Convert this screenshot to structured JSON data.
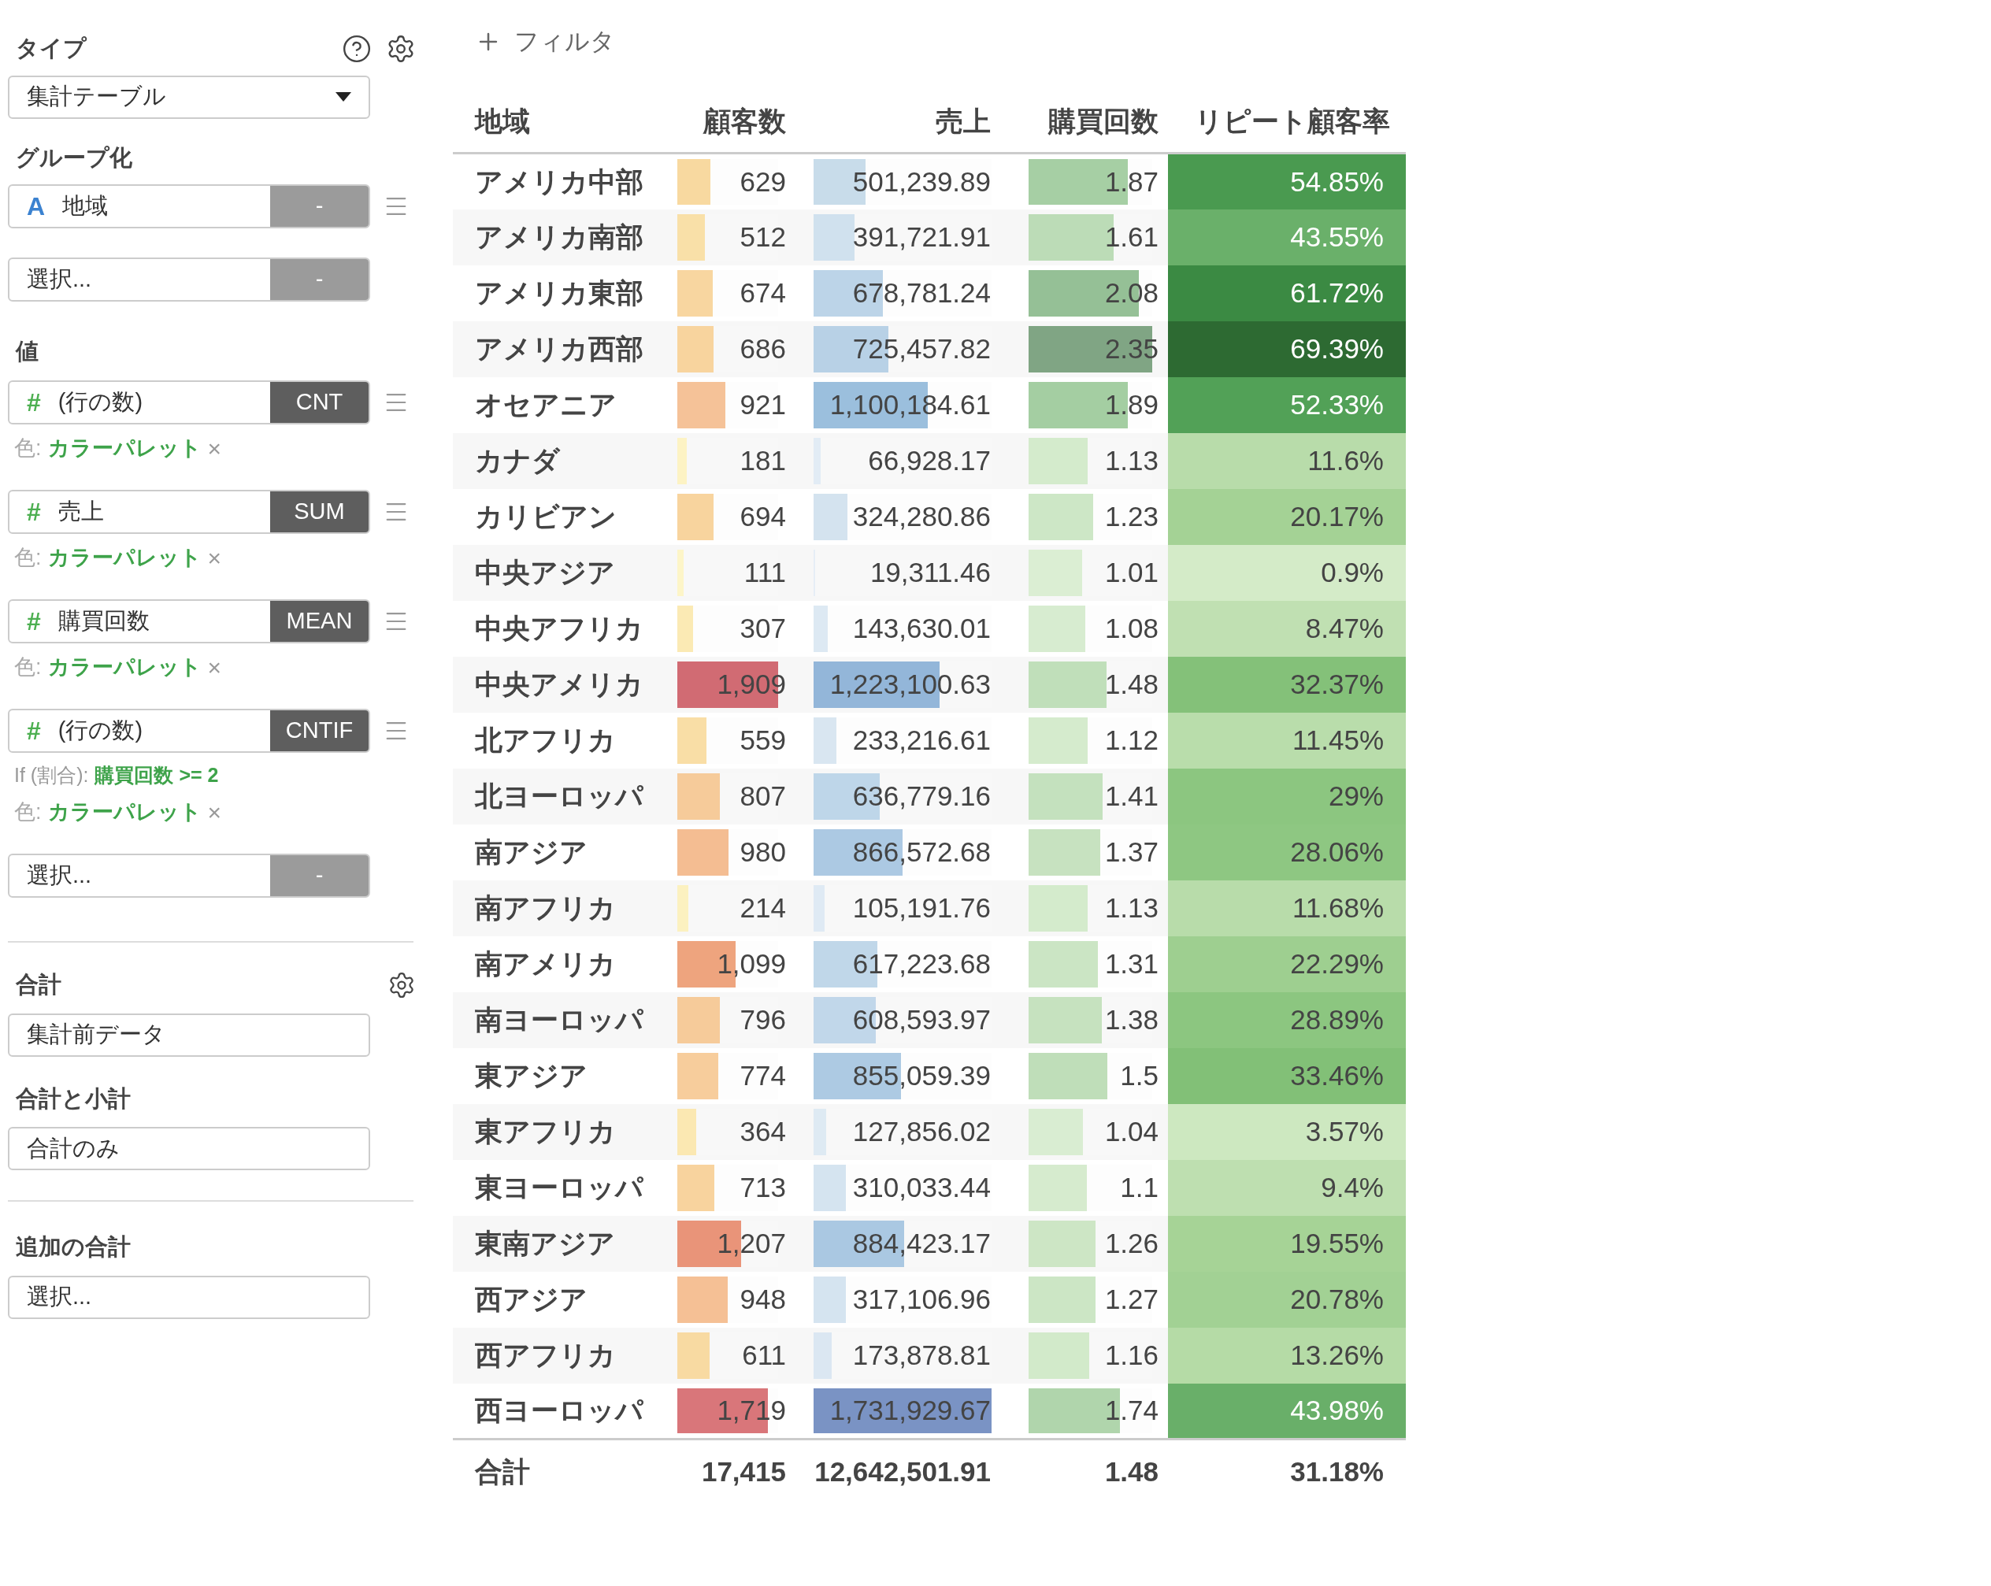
{
  "sidebar": {
    "type_label": "タイプ",
    "type_select": "集計テーブル",
    "grouping_label": "グループ化",
    "groups": [
      {
        "kind": "field",
        "icon": "A",
        "name": "地域",
        "agg": "-"
      },
      {
        "kind": "empty",
        "name": "選択...",
        "agg": "-"
      }
    ],
    "values_label": "値",
    "values": [
      {
        "kind": "field",
        "icon": "#",
        "name": "(行の数)",
        "agg": "CNT",
        "color_label": "色:",
        "color_value": "カラーパレット",
        "remove": "×"
      },
      {
        "kind": "field",
        "icon": "#",
        "name": "売上",
        "agg": "SUM",
        "color_label": "色:",
        "color_value": "カラーパレット",
        "remove": "×"
      },
      {
        "kind": "field",
        "icon": "#",
        "name": "購買回数",
        "agg": "MEAN",
        "color_label": "色:",
        "color_value": "カラーパレット",
        "remove": "×"
      },
      {
        "kind": "field",
        "icon": "#",
        "name": "(行の数)",
        "agg": "CNTIF",
        "condition_label": "If (割合):",
        "condition_value": "購買回数 >= 2",
        "color_label": "色:",
        "color_value": "カラーパレット",
        "remove": "×"
      },
      {
        "kind": "empty",
        "name": "選択...",
        "agg": "-"
      }
    ],
    "total_label": "合計",
    "total_select": "集計前データ",
    "subtotal_label": "合計と小計",
    "subtotal_select": "合計のみ",
    "extra_label": "追加の合計",
    "extra_select": "選択..."
  },
  "filter": "フィルタ",
  "table": {
    "columns": [
      "地域",
      "顧客数",
      "売上",
      "購買回数",
      "リピート顧客率"
    ],
    "rows": [
      {
        "region": "アメリカ中部",
        "count": {
          "text": "629",
          "level": 0.33,
          "color": "#f8d9a0"
        },
        "sales": {
          "text": "501,239.89",
          "level": 0.29,
          "color": "#c8dcea"
        },
        "purchases": {
          "text": "1.87",
          "level": 0.8,
          "color": "#a6cfa4"
        },
        "repeat": {
          "text": "54.85%",
          "color": "#4a9a50"
        }
      },
      {
        "region": "アメリカ南部",
        "count": {
          "text": "512",
          "level": 0.27,
          "color": "#f9e0a8"
        },
        "sales": {
          "text": "391,721.91",
          "level": 0.23,
          "color": "#d0e1ee"
        },
        "purchases": {
          "text": "1.61",
          "level": 0.69,
          "color": "#bcdcb7"
        },
        "repeat": {
          "text": "43.55%",
          "color": "#6ab06a"
        }
      },
      {
        "region": "アメリカ東部",
        "count": {
          "text": "674",
          "level": 0.35,
          "color": "#f8d6a0"
        },
        "sales": {
          "text": "678,781.24",
          "level": 0.39,
          "color": "#bcd4e8"
        },
        "purchases": {
          "text": "2.08",
          "level": 0.89,
          "color": "#95c096"
        },
        "repeat": {
          "text": "61.72%",
          "color": "#3b8a43"
        }
      },
      {
        "region": "アメリカ西部",
        "count": {
          "text": "686",
          "level": 0.36,
          "color": "#f8d49e"
        },
        "sales": {
          "text": "725,457.82",
          "level": 0.42,
          "color": "#b8d1e6"
        },
        "purchases": {
          "text": "2.35",
          "level": 1,
          "color": "#80a584"
        },
        "repeat": {
          "text": "69.39%",
          "color": "#2d6a32"
        }
      },
      {
        "region": "オセアニア",
        "count": {
          "text": "921",
          "level": 0.48,
          "color": "#f5c298"
        },
        "sales": {
          "text": "1,100,184.61",
          "level": 0.64,
          "color": "#9bbfdd"
        },
        "purchases": {
          "text": "1.89",
          "level": 0.8,
          "color": "#a4cea2"
        },
        "repeat": {
          "text": "52.33%",
          "color": "#52a157"
        }
      },
      {
        "region": "カナダ",
        "count": {
          "text": "181",
          "level": 0.09,
          "color": "#fdf3c4"
        },
        "sales": {
          "text": "66,928.17",
          "level": 0.04,
          "color": "#e2ecf5"
        },
        "purchases": {
          "text": "1.13",
          "level": 0.48,
          "color": "#d4ebcc"
        },
        "repeat": {
          "text": "11.6%",
          "color": "#b8dcaa"
        }
      },
      {
        "region": "カリビアン",
        "count": {
          "text": "694",
          "level": 0.36,
          "color": "#f8d49e"
        },
        "sales": {
          "text": "324,280.86",
          "level": 0.19,
          "color": "#d4e3ef"
        },
        "purchases": {
          "text": "1.23",
          "level": 0.52,
          "color": "#cde7c6"
        },
        "repeat": {
          "text": "20.17%",
          "color": "#a4d295"
        }
      },
      {
        "region": "中央アジア",
        "count": {
          "text": "111",
          "level": 0.06,
          "color": "#fdf5c8"
        },
        "sales": {
          "text": "19,311.46",
          "level": 0.01,
          "color": "#e6eef6"
        },
        "purchases": {
          "text": "1.01",
          "level": 0.43,
          "color": "#dbeed3"
        },
        "repeat": {
          "text": "0.9%",
          "color": "#d4ebc8"
        }
      },
      {
        "region": "中央アフリカ",
        "count": {
          "text": "307",
          "level": 0.16,
          "color": "#fbeab4"
        },
        "sales": {
          "text": "143,630.01",
          "level": 0.08,
          "color": "#dde9f3"
        },
        "purchases": {
          "text": "1.08",
          "level": 0.46,
          "color": "#d7ecd0"
        },
        "repeat": {
          "text": "8.47%",
          "color": "#c0e0b2"
        }
      },
      {
        "region": "中央アメリカ",
        "count": {
          "text": "1,909",
          "level": 1,
          "color": "#d16b73"
        },
        "sales": {
          "text": "1,223,100.63",
          "level": 0.71,
          "color": "#93b6d9"
        },
        "purchases": {
          "text": "1.48",
          "level": 0.63,
          "color": "#c0dfba"
        },
        "repeat": {
          "text": "32.37%",
          "color": "#84c179"
        }
      },
      {
        "region": "北アフリカ",
        "count": {
          "text": "559",
          "level": 0.29,
          "color": "#f9dea6"
        },
        "sales": {
          "text": "233,216.61",
          "level": 0.13,
          "color": "#d9e6f1"
        },
        "purchases": {
          "text": "1.12",
          "level": 0.48,
          "color": "#d5ebcd"
        },
        "repeat": {
          "text": "11.45%",
          "color": "#b9ddab"
        }
      },
      {
        "region": "北ヨーロッパ",
        "count": {
          "text": "807",
          "level": 0.42,
          "color": "#f6cb9a"
        },
        "sales": {
          "text": "636,779.16",
          "level": 0.37,
          "color": "#bed6e9"
        },
        "purchases": {
          "text": "1.41",
          "level": 0.6,
          "color": "#c4e1be"
        },
        "repeat": {
          "text": "29%",
          "color": "#8cc680"
        }
      },
      {
        "region": "南アジア",
        "count": {
          "text": "980",
          "level": 0.51,
          "color": "#f4bd92"
        },
        "sales": {
          "text": "866,572.68",
          "level": 0.5,
          "color": "#acc9e3"
        },
        "purchases": {
          "text": "1.37",
          "level": 0.58,
          "color": "#c7e2c0"
        },
        "repeat": {
          "text": "28.06%",
          "color": "#8ec782"
        }
      },
      {
        "region": "南アフリカ",
        "count": {
          "text": "214",
          "level": 0.11,
          "color": "#fcf1c0"
        },
        "sales": {
          "text": "105,191.76",
          "level": 0.06,
          "color": "#dfeaf4"
        },
        "purchases": {
          "text": "1.13",
          "level": 0.48,
          "color": "#d4ebcc"
        },
        "repeat": {
          "text": "11.68%",
          "color": "#b8dcaa"
        }
      },
      {
        "region": "南アメリカ",
        "count": {
          "text": "1,099",
          "level": 0.58,
          "color": "#eea47e"
        },
        "sales": {
          "text": "617,223.68",
          "level": 0.36,
          "color": "#c0d7e9"
        },
        "purchases": {
          "text": "1.31",
          "level": 0.56,
          "color": "#cbe5c4"
        },
        "repeat": {
          "text": "22.29%",
          "color": "#9ecf90"
        }
      },
      {
        "region": "南ヨーロッパ",
        "count": {
          "text": "796",
          "level": 0.42,
          "color": "#f6cb9a"
        },
        "sales": {
          "text": "608,593.97",
          "level": 0.35,
          "color": "#c1d7ea"
        },
        "purchases": {
          "text": "1.38",
          "level": 0.59,
          "color": "#c6e2bf"
        },
        "repeat": {
          "text": "28.89%",
          "color": "#8cc680"
        }
      },
      {
        "region": "東アジア",
        "count": {
          "text": "774",
          "level": 0.41,
          "color": "#f7cd9c"
        },
        "sales": {
          "text": "855,059.39",
          "level": 0.49,
          "color": "#adcae3"
        },
        "purchases": {
          "text": "1.5",
          "level": 0.64,
          "color": "#bfdeb9"
        },
        "repeat": {
          "text": "33.46%",
          "color": "#82c077"
        }
      },
      {
        "region": "東アフリカ",
        "count": {
          "text": "364",
          "level": 0.19,
          "color": "#fbe8b2"
        },
        "sales": {
          "text": "127,856.02",
          "level": 0.07,
          "color": "#deeaf3"
        },
        "purchases": {
          "text": "1.04",
          "level": 0.44,
          "color": "#d9edd2"
        },
        "repeat": {
          "text": "3.57%",
          "color": "#cde8c0"
        }
      },
      {
        "region": "東ヨーロッパ",
        "count": {
          "text": "713",
          "level": 0.37,
          "color": "#f8d39e"
        },
        "sales": {
          "text": "310,033.44",
          "level": 0.18,
          "color": "#d5e4f0"
        },
        "purchases": {
          "text": "1.1",
          "level": 0.47,
          "color": "#d6ebce"
        },
        "repeat": {
          "text": "9.4%",
          "color": "#bedfb0"
        }
      },
      {
        "region": "東南アジア",
        "count": {
          "text": "1,207",
          "level": 0.63,
          "color": "#e99479"
        },
        "sales": {
          "text": "884,423.17",
          "level": 0.51,
          "color": "#aac8e2"
        },
        "purchases": {
          "text": "1.26",
          "level": 0.54,
          "color": "#cde6c5"
        },
        "repeat": {
          "text": "19.55%",
          "color": "#a6d396"
        }
      },
      {
        "region": "西アジア",
        "count": {
          "text": "948",
          "level": 0.5,
          "color": "#f5c095"
        },
        "sales": {
          "text": "317,106.96",
          "level": 0.18,
          "color": "#d5e4f0"
        },
        "purchases": {
          "text": "1.27",
          "level": 0.54,
          "color": "#cce6c5"
        },
        "repeat": {
          "text": "20.78%",
          "color": "#a2d194"
        }
      },
      {
        "region": "西アフリカ",
        "count": {
          "text": "611",
          "level": 0.32,
          "color": "#f8daa2"
        },
        "sales": {
          "text": "173,878.81",
          "level": 0.1,
          "color": "#dbe7f2"
        },
        "purchases": {
          "text": "1.16",
          "level": 0.49,
          "color": "#d2eaca"
        },
        "repeat": {
          "text": "13.26%",
          "color": "#b5dba6"
        }
      },
      {
        "region": "西ヨーロッパ",
        "count": {
          "text": "1,719",
          "level": 0.9,
          "color": "#d9767a"
        },
        "sales": {
          "text": "1,731,929.67",
          "level": 1,
          "color": "#7a93c4"
        },
        "purchases": {
          "text": "1.74",
          "level": 0.74,
          "color": "#b0d5ac"
        },
        "repeat": {
          "text": "43.98%",
          "color": "#69af69"
        }
      }
    ],
    "total": {
      "label": "合計",
      "count": "17,415",
      "sales": "12,642,501.91",
      "purchases": "1.48",
      "repeat": "31.18%"
    }
  }
}
